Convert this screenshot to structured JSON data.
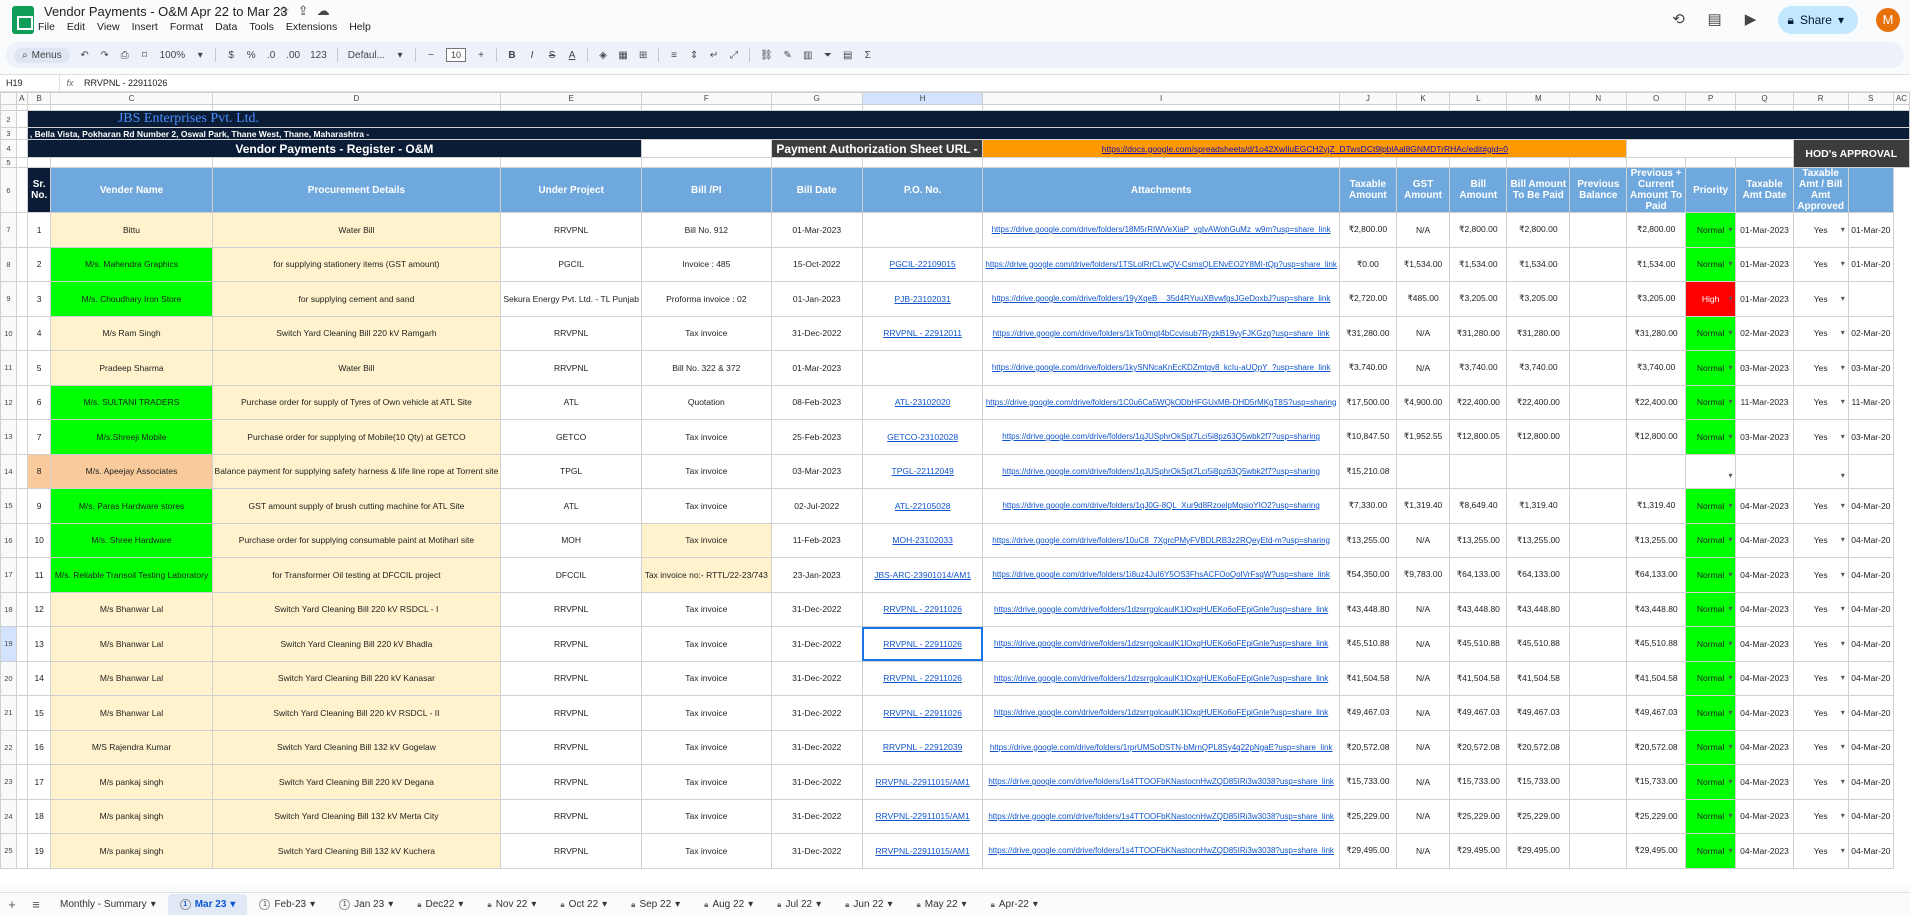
{
  "window": {
    "doc_title": "Vendor Payments - O&M Apr 22 to Mar 23",
    "menus": [
      "File",
      "Edit",
      "View",
      "Insert",
      "Format",
      "Data",
      "Tools",
      "Extensions",
      "Help"
    ],
    "share_label": "Share",
    "avatar_letter": "M"
  },
  "toolbar": {
    "menus_label": "Menus",
    "zoom": "100%",
    "currency": "$",
    "percent": "%",
    "dec_decrease": ".0",
    "dec_increase": ".00",
    "number_format": "123",
    "font": "Defaul...",
    "font_size": "10",
    "bold": "B",
    "italic": "I",
    "underline": "A",
    "functions": "Σ"
  },
  "formula_bar": {
    "cell_ref": "H19",
    "fx": "fx",
    "content": "RRVPNL - 22911026"
  },
  "columns": [
    "A",
    "B",
    "C",
    "D",
    "E",
    "F",
    "G",
    "H",
    "I",
    "J",
    "K",
    "L",
    "M",
    "N",
    "O",
    "P",
    "Q",
    "R",
    "S",
    "AC"
  ],
  "sheet": {
    "company": "JBS Enterprises Pvt. Ltd.",
    "address": ", Bella Vista, Pokharan Rd Number 2, Oswal Park, Thane West, Thane, Maharashtra -",
    "register_title": "Vendor Payments - Register - O&M",
    "auth_label": "Payment Authorization Sheet URL -",
    "auth_url": "https://docs.google.com/spreadsheets/d/1o42XwIluEGCH2yjZ_DTwsDCt9lpblAal8GNMDTrRHAc/edit#gid=0",
    "hod_label": "HOD's APPROVAL",
    "headers": [
      "Sr. No.",
      "Vender Name",
      "Procurement Details",
      "Under Project",
      "Bill /PI",
      "Bill Date",
      "P.O. No.",
      "Attachments",
      "Taxable Amount",
      "GST Amount",
      "Bill Amount",
      "Bill Amount To Be Paid",
      "Previous Balance",
      "Previous + Current Amount To Paid",
      "Priority",
      "Taxable Amt Date",
      "Taxable Amt / Bill Amt Approved",
      ""
    ],
    "rows": [
      {
        "rn": "7",
        "sr": "1",
        "vendor": "Bittu",
        "vc": "cream",
        "proc": "Water Bill",
        "project": "RRVPNL",
        "bill": "Bill No. 912",
        "bc": "",
        "date": "01-Mar-2023",
        "po": "",
        "att": "https://drive.google.com/drive/folders/18M5rRIWVeXiaP_vgIvAWohGuMz_w9m?usp=share_link",
        "tax": "₹2,800.00",
        "gst": "N/A",
        "amt": "₹2,800.00",
        "pay": "₹2,800.00",
        "prev": "",
        "total": "₹2,800.00",
        "pri": "Normal",
        "pc": "green",
        "tdate": "01-Mar-2023",
        "appr": "Yes",
        "ac": "01-Mar-20"
      },
      {
        "rn": "8",
        "sr": "2",
        "vendor": "M/s. Mahendra Graphics",
        "vc": "green",
        "proc": "for supplying stationery items (GST amount)",
        "project": "PGCIL",
        "bill": "Invoice : 485",
        "bc": "",
        "date": "15-Oct-2022",
        "po": "PGCIL-22109015",
        "att": "https://drive.google.com/drive/folders/1TSLolRrCLwQV-CsmsQLENvEO2Y8MI-tQp?usp=share_link",
        "tax": "₹0.00",
        "gst": "₹1,534.00",
        "amt": "₹1,534.00",
        "pay": "₹1,534.00",
        "prev": "",
        "total": "₹1,534.00",
        "pri": "Normal",
        "pc": "green",
        "tdate": "01-Mar-2023",
        "appr": "Yes",
        "ac": "01-Mar-20"
      },
      {
        "rn": "9",
        "sr": "3",
        "vendor": "M/s. Choudhary Iron Store",
        "vc": "green",
        "proc": "for supplying cement and sand",
        "project": "Sekura Energy Pvt. Ltd. - TL Punjab",
        "bill": "Proforma invoice : 02",
        "bc": "",
        "date": "01-Jan-2023",
        "po": "PJB-23102031",
        "att": "https://drive.google.com/drive/folders/19yXqeB__35d4RYuuXBvwfgsJGeDoxbJ?usp=share_link",
        "tax": "₹2,720.00",
        "gst": "₹485.00",
        "amt": "₹3,205.00",
        "pay": "₹3,205.00",
        "prev": "",
        "total": "₹3,205.00",
        "pri": "High",
        "pc": "red",
        "tdate": "01-Mar-2023",
        "appr": "Yes",
        "ac": ""
      },
      {
        "rn": "10",
        "sr": "4",
        "vendor": "M/s Ram Singh",
        "vc": "cream",
        "proc": "Switch Yard Cleaning Bill 220 kV Ramgarh",
        "project": "RRVPNL",
        "bill": "Tax invoice",
        "bc": "",
        "date": "31-Dec-2022",
        "po": "RRVPNL - 22912011",
        "att": "https://drive.google.com/drive/folders/1kTo0mqt4bCcvisub7RyzkB19vyFJKGzq?usp=share_link",
        "tax": "₹31,280.00",
        "gst": "N/A",
        "amt": "₹31,280.00",
        "pay": "₹31,280.00",
        "prev": "",
        "total": "₹31,280.00",
        "pri": "Normal",
        "pc": "green",
        "tdate": "02-Mar-2023",
        "appr": "Yes",
        "ac": "02-Mar-20"
      },
      {
        "rn": "11",
        "sr": "5",
        "vendor": "Pradeep Sharma",
        "vc": "cream",
        "proc": "Water Bill",
        "project": "RRVPNL",
        "bill": "Bill No. 322 & 372",
        "bc": "",
        "date": "01-Mar-2023",
        "po": "",
        "att": "https://drive.google.com/drive/folders/1kySNNcaKnEcKDZmtgv8_kcIu-aUQpY_?usp=share_link",
        "tax": "₹3,740.00",
        "gst": "N/A",
        "amt": "₹3,740.00",
        "pay": "₹3,740.00",
        "prev": "",
        "total": "₹3,740.00",
        "pri": "Normal",
        "pc": "green",
        "tdate": "03-Mar-2023",
        "appr": "Yes",
        "ac": "03-Mar-20"
      },
      {
        "rn": "12",
        "sr": "6",
        "vendor": "M/s. SULTANI TRADERS",
        "vc": "green",
        "proc": "Purchase order for supply of Tyres of Own vehicle at ATL Site",
        "project": "ATL",
        "bill": "Quotation",
        "bc": "",
        "date": "08-Feb-2023",
        "po": "ATL-23102020",
        "att": "https://drive.google.com/drive/folders/1C0u6Ca5WQkODbHFGUxMB-DHD5rMKgT8S?usp=sharing",
        "tax": "₹17,500.00",
        "gst": "₹4,900.00",
        "amt": "₹22,400.00",
        "pay": "₹22,400.00",
        "prev": "",
        "total": "₹22,400.00",
        "pri": "Normal",
        "pc": "green",
        "tdate": "11-Mar-2023",
        "appr": "Yes",
        "ac": "11-Mar-20"
      },
      {
        "rn": "13",
        "sr": "7",
        "vendor": "M/s.Shreeji Mobile",
        "vc": "green",
        "proc": "Purchase order for supplying of Mobile(10 Qty) at GETCO",
        "project": "GETCO",
        "bill": "Tax invoice",
        "bc": "",
        "date": "25-Feb-2023",
        "po": "GETCO-23102028",
        "att": "https://drive.google.com/drive/folders/1qJUSphrOkSpt7Lci5i8pz63Q5wbk2f7?usp=sharing",
        "tax": "₹10,847.50",
        "gst": "₹1,952.55",
        "amt": "₹12,800.05",
        "pay": "₹12,800.00",
        "prev": "",
        "total": "₹12,800.00",
        "pri": "Normal",
        "pc": "green",
        "tdate": "03-Mar-2023",
        "appr": "Yes",
        "ac": "03-Mar-20"
      },
      {
        "rn": "14",
        "sr": "8",
        "vendor": "M/s. Apeejay Associates",
        "vc": "peach",
        "proc": "Balance payment for supplying safety harness & life line rope at Torrent site",
        "project": "TPGL",
        "bill": "Tax invoice",
        "bc": "",
        "date": "03-Mar-2023",
        "po": "TPGL-22112049",
        "att": "https://drive.google.com/drive/folders/1qJUSphrOkSpt7Lci5i8pz63Q5wbk2f7?usp=sharing",
        "tax": "₹15,210.08",
        "gst": "",
        "amt": "",
        "pay": "",
        "prev": "",
        "total": "",
        "pri": "",
        "pc": "",
        "tdate": "",
        "appr": "",
        "ac": ""
      },
      {
        "rn": "15",
        "sr": "9",
        "vendor": "M/s. Paras Hardware stores",
        "vc": "green",
        "proc": "GST amount supply of brush cutting machine for ATL Site",
        "project": "ATL",
        "bill": "Tax invoice",
        "bc": "",
        "date": "02-Jul-2022",
        "po": "ATL-22105028",
        "att": "https://drive.google.com/drive/folders/1qJ0G-8QL_Xur9d8RzoelpMqsioYIO2?usp=sharing",
        "tax": "₹7,330.00",
        "gst": "₹1,319.40",
        "amt": "₹8,649.40",
        "pay": "₹1,319.40",
        "prev": "",
        "total": "₹1,319.40",
        "pri": "Normal",
        "pc": "green",
        "tdate": "04-Mar-2023",
        "appr": "Yes",
        "ac": "04-Mar-20"
      },
      {
        "rn": "16",
        "sr": "10",
        "vendor": "M/s. Shree Hardware",
        "vc": "green",
        "proc": "Purchase order for supplying consumable paint at Motihari site",
        "project": "MOH",
        "bill": "Tax invoice",
        "bc": "cream",
        "date": "11-Feb-2023",
        "po": "MOH-23102033",
        "att": "https://drive.google.com/drive/folders/10uC8_7XgrcPMyFVBDLRB3z2RQeyEtd-m?usp=sharing",
        "tax": "₹13,255.00",
        "gst": "N/A",
        "amt": "₹13,255.00",
        "pay": "₹13,255.00",
        "prev": "",
        "total": "₹13,255.00",
        "pri": "Normal",
        "pc": "green",
        "tdate": "04-Mar-2023",
        "appr": "Yes",
        "ac": "04-Mar-20"
      },
      {
        "rn": "17",
        "sr": "11",
        "vendor": "M/s. Reliable Transoil Testing Laboratory",
        "vc": "green",
        "proc": "for Transformer Oil testing at DFCCIL project",
        "project": "DFCCIL",
        "bill": "Tax invoice no:- RTTL/22-23/743",
        "bc": "cream",
        "date": "23-Jan-2023",
        "po": "JBS-ARC-23901014/AM1",
        "att": "https://drive.google.com/drive/folders/1i8uz4JuI6Y5OS3FhsACFOoQoIVrFsqW?usp=share_link",
        "tax": "₹54,350.00",
        "gst": "₹9,783.00",
        "amt": "₹64,133.00",
        "pay": "₹64,133.00",
        "prev": "",
        "total": "₹64,133.00",
        "pri": "Normal",
        "pc": "green",
        "tdate": "04-Mar-2023",
        "appr": "Yes",
        "ac": "04-Mar-20"
      },
      {
        "rn": "18",
        "sr": "12",
        "vendor": "M/s Bhanwar Lal",
        "vc": "cream",
        "proc": "Switch Yard Cleaning Bill 220 kV RSDCL - I",
        "project": "RRVPNL",
        "bill": "Tax invoice",
        "bc": "",
        "date": "31-Dec-2022",
        "po": "RRVPNL - 22911026",
        "att": "https://drive.google.com/drive/folders/1dzsrrgolcaulK1lOxqHUEKo6oFEpiGnle?usp=share_link",
        "tax": "₹43,448.80",
        "gst": "N/A",
        "amt": "₹43,448.80",
        "pay": "₹43,448.80",
        "prev": "",
        "total": "₹43,448.80",
        "pri": "Normal",
        "pc": "green",
        "tdate": "04-Mar-2023",
        "appr": "Yes",
        "ac": "04-Mar-20"
      },
      {
        "rn": "19",
        "sr": "13",
        "vendor": "M/s Bhanwar Lal",
        "vc": "cream",
        "proc": "Switch Yard Cleaning Bill 220 kV Bhadla",
        "project": "RRVPNL",
        "bill": "Tax invoice",
        "bc": "",
        "date": "31-Dec-2022",
        "po": "RRVPNL - 22911026",
        "att": "https://drive.google.com/drive/folders/1dzsrrgolcaulK1lOxqHUEKo6oFEpiGnle?usp=share_link",
        "tax": "₹45,510.88",
        "gst": "N/A",
        "amt": "₹45,510.88",
        "pay": "₹45,510.88",
        "prev": "",
        "total": "₹45,510.88",
        "pri": "Normal",
        "pc": "green",
        "tdate": "04-Mar-2023",
        "appr": "Yes",
        "ac": "04-Mar-20"
      },
      {
        "rn": "20",
        "sr": "14",
        "vendor": "M/s Bhanwar Lal",
        "vc": "cream",
        "proc": "Switch Yard Cleaning Bill 220 kV Kanasar",
        "project": "RRVPNL",
        "bill": "Tax invoice",
        "bc": "",
        "date": "31-Dec-2022",
        "po": "RRVPNL - 22911026",
        "att": "https://drive.google.com/drive/folders/1dzsrrgolcaulK1lOxqHUEKo6oFEpiGnle?usp=share_link",
        "tax": "₹41,504.58",
        "gst": "N/A",
        "amt": "₹41,504.58",
        "pay": "₹41,504.58",
        "prev": "",
        "total": "₹41,504.58",
        "pri": "Normal",
        "pc": "green",
        "tdate": "04-Mar-2023",
        "appr": "Yes",
        "ac": "04-Mar-20"
      },
      {
        "rn": "21",
        "sr": "15",
        "vendor": "M/s Bhanwar Lal",
        "vc": "cream",
        "proc": "Switch Yard Cleaning Bill 220 kV RSDCL - II",
        "project": "RRVPNL",
        "bill": "Tax invoice",
        "bc": "",
        "date": "31-Dec-2022",
        "po": "RRVPNL - 22911026",
        "att": "https://drive.google.com/drive/folders/1dzsrrgolcaulK1lOxqHUEKo6oFEpiGnle?usp=share_link",
        "tax": "₹49,467.03",
        "gst": "N/A",
        "amt": "₹49,467.03",
        "pay": "₹49,467.03",
        "prev": "",
        "total": "₹49,467.03",
        "pri": "Normal",
        "pc": "green",
        "tdate": "04-Mar-2023",
        "appr": "Yes",
        "ac": "04-Mar-20"
      },
      {
        "rn": "22",
        "sr": "16",
        "vendor": "M/S Rajendra Kumar",
        "vc": "cream",
        "proc": "Switch Yard Cleaning Bill 132 kV Gogelaw",
        "project": "RRVPNL",
        "bill": "Tax invoice",
        "bc": "",
        "date": "31-Dec-2022",
        "po": "RRVPNL - 22912039",
        "att": "https://drive.google.com/drive/folders/1rprUMSoDSTN-bMrnQPL8Sy4q22pNgaE?usp=share_link",
        "tax": "₹20,572.08",
        "gst": "N/A",
        "amt": "₹20,572.08",
        "pay": "₹20,572.08",
        "prev": "",
        "total": "₹20,572.08",
        "pri": "Normal",
        "pc": "green",
        "tdate": "04-Mar-2023",
        "appr": "Yes",
        "ac": "04-Mar-20"
      },
      {
        "rn": "23",
        "sr": "17",
        "vendor": "M/s pankaj singh",
        "vc": "cream",
        "proc": "Switch Yard Cleaning Bill 220 kV Degana",
        "project": "RRVPNL",
        "bill": "Tax invoice",
        "bc": "",
        "date": "31-Dec-2022",
        "po": "RRVPNL-22911015/AM1",
        "att": "https://drive.google.com/drive/folders/1s4TTOOFbKNastocnHwZQD85IRi3w3038?usp=share_link",
        "tax": "₹15,733.00",
        "gst": "N/A",
        "amt": "₹15,733.00",
        "pay": "₹15,733.00",
        "prev": "",
        "total": "₹15,733.00",
        "pri": "Normal",
        "pc": "green",
        "tdate": "04-Mar-2023",
        "appr": "Yes",
        "ac": "04-Mar-20"
      },
      {
        "rn": "24",
        "sr": "18",
        "vendor": "M/s pankaj singh",
        "vc": "cream",
        "proc": "Switch Yard Cleaning Bill 132 kV Merta City",
        "project": "RRVPNL",
        "bill": "Tax invoice",
        "bc": "",
        "date": "31-Dec-2022",
        "po": "RRVPNL-22911015/AM1",
        "att": "https://drive.google.com/drive/folders/1s4TTOOFbKNastocnHwZQD85IRi3w3038?usp=share_link",
        "tax": "₹25,229.00",
        "gst": "N/A",
        "amt": "₹25,229.00",
        "pay": "₹25,229.00",
        "prev": "",
        "total": "₹25,229.00",
        "pri": "Normal",
        "pc": "green",
        "tdate": "04-Mar-2023",
        "appr": "Yes",
        "ac": "04-Mar-20"
      },
      {
        "rn": "25",
        "sr": "19",
        "vendor": "M/s pankaj singh",
        "vc": "cream",
        "proc": "Switch Yard Cleaning Bill 132 kV Kuchera",
        "project": "RRVPNL",
        "bill": "Tax invoice",
        "bc": "",
        "date": "31-Dec-2022",
        "po": "RRVPNL-22911015/AM1",
        "att": "https://drive.google.com/drive/folders/1s4TTOOFbKNastocnHwZQD85IRi3w3038?usp=share_link",
        "tax": "₹29,495.00",
        "gst": "N/A",
        "amt": "₹29,495.00",
        "pay": "₹29,495.00",
        "prev": "",
        "total": "₹29,495.00",
        "pri": "Normal",
        "pc": "green",
        "tdate": "04-Mar-2023",
        "appr": "Yes",
        "ac": "04-Mar-20"
      }
    ]
  },
  "tabs": [
    {
      "label": "Monthly - Summary",
      "active": false,
      "lock": false,
      "badge": ""
    },
    {
      "label": "Mar 23",
      "active": true,
      "lock": false,
      "badge": "1"
    },
    {
      "label": "Feb-23",
      "active": false,
      "lock": false,
      "badge": "1"
    },
    {
      "label": "Jan 23",
      "active": false,
      "lock": false,
      "badge": "1"
    },
    {
      "label": "Dec22",
      "active": false,
      "lock": true,
      "badge": ""
    },
    {
      "label": "Nov 22",
      "active": false,
      "lock": true,
      "badge": ""
    },
    {
      "label": "Oct 22",
      "active": false,
      "lock": true,
      "badge": ""
    },
    {
      "label": "Sep 22",
      "active": false,
      "lock": true,
      "badge": ""
    },
    {
      "label": "Aug 22",
      "active": false,
      "lock": true,
      "badge": ""
    },
    {
      "label": "Jul 22",
      "active": false,
      "lock": true,
      "badge": ""
    },
    {
      "label": "Jun 22",
      "active": false,
      "lock": true,
      "badge": ""
    },
    {
      "label": "May 22",
      "active": false,
      "lock": true,
      "badge": ""
    },
    {
      "label": "Apr-22",
      "active": false,
      "lock": true,
      "badge": ""
    }
  ]
}
